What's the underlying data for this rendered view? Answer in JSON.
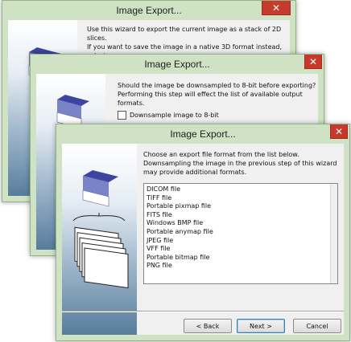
{
  "dialogs": [
    {
      "title": "Image Export...",
      "close": "✕",
      "text": "Use this wizard to export the current image as a stack of 2D slices.\nIf you want to save the image in a native 3D format instead, select\nFile -> Save As... from the application menu."
    },
    {
      "title": "Image Export...",
      "close": "✕",
      "text": "Should the image be downsampled to 8-bit before exporting?\nPerforming this step will effect the list of available output formats.",
      "checkbox_label": "Downsample image to 8-bit",
      "checkbox_checked": false
    },
    {
      "title": "Image Export...",
      "close": "✕",
      "text": "Choose an export file format from the list below.\nDownsampling the image in the previous step of this wizard\nmay provide additional formats.",
      "formats": [
        "DICOM file",
        "TIFF file",
        "Portable pixmap file",
        "FITS file",
        "Windows BMP file",
        "Portable anymap file",
        "JPEG file",
        "VFF file",
        "Portable bitmap file",
        "PNG file"
      ],
      "buttons": {
        "back": "< Back",
        "next": "Next >",
        "cancel": "Cancel"
      }
    }
  ],
  "colors": {
    "frame": "#cfe3c4",
    "close": "#c7392c",
    "side_dark": "#577d9c"
  },
  "icons": [
    "cube-icon",
    "stack-icon"
  ]
}
